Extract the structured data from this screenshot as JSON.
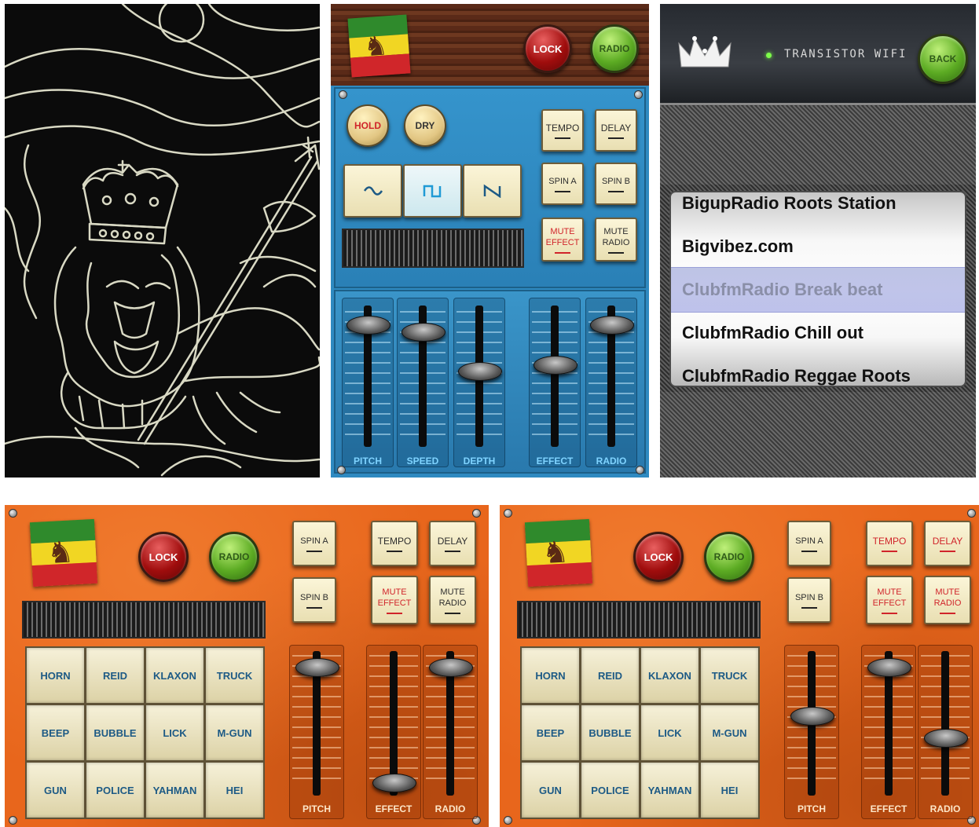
{
  "screen_art": {
    "description_icons": [
      "crown-icon",
      "lion-icon",
      "scepter-icon",
      "flag-icon"
    ]
  },
  "blue_screen": {
    "top": {
      "lock_label": "LOCK",
      "radio_label": "RADIO"
    },
    "hold_label": "HOLD",
    "dry_label": "DRY",
    "wave_icons": [
      "sine-wave-icon",
      "square-wave-icon",
      "sawtooth-wave-icon"
    ],
    "buttons": {
      "tempo": "TEMPO",
      "delay": "DELAY",
      "spin_a": "SPIN A",
      "spin_b": "SPIN B",
      "mute_effect_1": "MUTE",
      "mute_effect_2": "EFFECT",
      "mute_radio_1": "MUTE",
      "mute_radio_2": "RADIO"
    },
    "sliders": [
      {
        "label": "PITCH",
        "level": 0.92
      },
      {
        "label": "SPEED",
        "level": 0.86
      },
      {
        "label": "DEPTH",
        "level": 0.55
      },
      {
        "label": "EFFECT",
        "level": 0.6
      },
      {
        "label": "RADIO",
        "level": 0.92
      }
    ],
    "colors": {
      "bg": "#2f8ac1",
      "label": "#7fd3ff",
      "red": "#d0242a"
    }
  },
  "radio_screen": {
    "title": "TRANSISTOR WIFI",
    "back_label": "BACK",
    "stations": [
      "BigupRadio Roots Station",
      "Bigvibez.com",
      "ClubfmRadio Break beat",
      "ClubfmRadio Chill out",
      "ClubfmRadio Reggae Roots"
    ],
    "selected_index": 2
  },
  "orange_left": {
    "lock_label": "LOCK",
    "radio_label": "RADIO",
    "spin_a": "SPIN A",
    "spin_b": "SPIN B",
    "tempo": "TEMPO",
    "delay": "DELAY",
    "mute_effect_1": "MUTE",
    "mute_effect_2": "EFFECT",
    "mute_radio_1": "MUTE",
    "mute_radio_2": "RADIO",
    "pads": [
      "HORN",
      "REID",
      "KLAXON",
      "TRUCK",
      "BEEP",
      "BUBBLE",
      "LICK",
      "M-GUN",
      "GUN",
      "POLICE",
      "YAHMAN",
      "HEI"
    ],
    "sliders": [
      {
        "label": "PITCH",
        "level": 0.95
      },
      {
        "label": "EFFECT",
        "level": 0.08
      },
      {
        "label": "RADIO",
        "level": 0.95
      }
    ]
  },
  "orange_right": {
    "lock_label": "LOCK",
    "radio_label": "RADIO",
    "spin_a": "SPIN A",
    "spin_b": "SPIN B",
    "tempo": "TEMPO",
    "delay": "DELAY",
    "mute_effect_1": "MUTE",
    "mute_effect_2": "EFFECT",
    "mute_radio_1": "MUTE",
    "mute_radio_2": "RADIO",
    "pads": [
      "HORN",
      "REID",
      "KLAXON",
      "TRUCK",
      "BEEP",
      "BUBBLE",
      "LICK",
      "M-GUN",
      "GUN",
      "POLICE",
      "YAHMAN",
      "HEI"
    ],
    "sliders": [
      {
        "label": "PITCH",
        "level": 0.58
      },
      {
        "label": "EFFECT",
        "level": 0.95
      },
      {
        "label": "RADIO",
        "level": 0.42
      }
    ]
  }
}
